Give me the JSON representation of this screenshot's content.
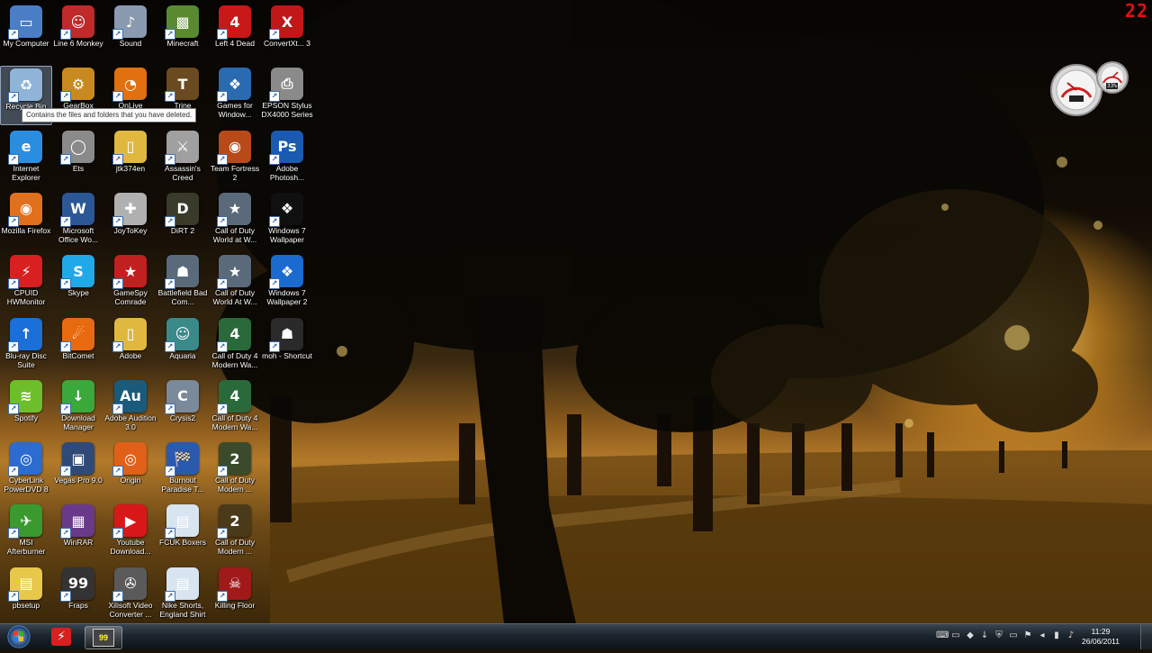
{
  "desktop": {
    "tooltip": "Contains the files and folders that you have deleted.",
    "counter": "22",
    "icons": [
      {
        "label": "My Computer",
        "icon": "computer-icon",
        "color": "#4a7fc8",
        "glyph": "▭"
      },
      {
        "label": "Recycle Bin",
        "icon": "recycle-bin-icon",
        "color": "#8fb4d8",
        "glyph": "♻",
        "selected": true
      },
      {
        "label": "Internet Explorer",
        "icon": "internet-explorer-icon",
        "color": "#2a8ee0",
        "glyph": "e"
      },
      {
        "label": "Mozilla Firefox",
        "icon": "firefox-icon",
        "color": "#e0701c",
        "glyph": "◉"
      },
      {
        "label": "CPUID HWMonitor",
        "icon": "hwmonitor-icon",
        "color": "#d82020",
        "glyph": "⚡"
      },
      {
        "label": "Blu-ray Disc Suite",
        "icon": "bluray-icon",
        "color": "#1b6fd8",
        "glyph": "↑"
      },
      {
        "label": "Spotify",
        "icon": "spotify-icon",
        "color": "#6cbf2a",
        "glyph": "≋"
      },
      {
        "label": "CyberLink PowerDVD 8",
        "icon": "powerdvd-icon",
        "color": "#2c6cd0",
        "glyph": "◎"
      },
      {
        "label": "MSI Afterburner",
        "icon": "afterburner-icon",
        "color": "#3a9a30",
        "glyph": "✈"
      },
      {
        "label": "pbsetup",
        "icon": "installer-icon",
        "color": "#e8c84a",
        "glyph": "▤"
      },
      {
        "label": "Line 6 Monkey",
        "icon": "monkey-icon",
        "color": "#c02a2a",
        "glyph": "☺"
      },
      {
        "label": "GearBox",
        "icon": "gear-icon",
        "color": "#c88a20",
        "glyph": "⚙"
      },
      {
        "label": "Ets",
        "icon": "steering-wheel-icon",
        "color": "#8a8a8a",
        "glyph": "◯"
      },
      {
        "label": "Microsoft Office Wo...",
        "icon": "word-icon",
        "color": "#2b5797",
        "glyph": "W"
      },
      {
        "label": "Skype",
        "icon": "skype-icon",
        "color": "#20a8e8",
        "glyph": "S"
      },
      {
        "label": "BitComet",
        "icon": "bitcomet-icon",
        "color": "#e86a10",
        "glyph": "☄"
      },
      {
        "label": "Download Manager",
        "icon": "download-icon",
        "color": "#3aa83a",
        "glyph": "↓"
      },
      {
        "label": "Vegas Pro 9.0",
        "icon": "vegas-icon",
        "color": "#304a78",
        "glyph": "▣"
      },
      {
        "label": "WinRAR",
        "icon": "winrar-icon",
        "color": "#6a3a8a",
        "glyph": "▦"
      },
      {
        "label": "Fraps",
        "icon": "fraps-icon",
        "color": "#333333",
        "glyph": "99"
      },
      {
        "label": "Sound",
        "icon": "sound-icon",
        "color": "#8a9ab0",
        "glyph": "♪"
      },
      {
        "label": "OnLive",
        "icon": "onlive-icon",
        "color": "#e07010",
        "glyph": "◔"
      },
      {
        "label": "jtk374en",
        "icon": "folder-icon",
        "color": "#e0b840",
        "glyph": "▯"
      },
      {
        "label": "JoyToKey",
        "icon": "joystick-icon",
        "color": "#b0b0b0",
        "glyph": "✚"
      },
      {
        "label": "GameSpy Comrade",
        "icon": "gamespy-icon",
        "color": "#c02020",
        "glyph": "★"
      },
      {
        "label": "Adobe",
        "icon": "folder-icon",
        "color": "#e0b840",
        "glyph": "▯"
      },
      {
        "label": "Adobe Audition 3.0",
        "icon": "audition-icon",
        "color": "#1a5a7a",
        "glyph": "Au"
      },
      {
        "label": "Origin",
        "icon": "origin-icon",
        "color": "#e0601a",
        "glyph": "◎"
      },
      {
        "label": "Youtube Download...",
        "icon": "youtube-icon",
        "color": "#d81818",
        "glyph": "▶"
      },
      {
        "label": "Xilisoft Video Converter ...",
        "icon": "film-reel-icon",
        "color": "#5a5a5a",
        "glyph": "✇"
      },
      {
        "label": "Minecraft",
        "icon": "minecraft-icon",
        "color": "#5a8a30",
        "glyph": "▩"
      },
      {
        "label": "Trine",
        "icon": "trine-icon",
        "color": "#6a4a20",
        "glyph": "T"
      },
      {
        "label": "Assassin's Creed",
        "icon": "assassins-creed-icon",
        "color": "#a0a0a0",
        "glyph": "⚔"
      },
      {
        "label": "DiRT 2",
        "icon": "dirt2-icon",
        "color": "#3a3a2a",
        "glyph": "D"
      },
      {
        "label": "Battlefield Bad Com...",
        "icon": "battlefield-icon",
        "color": "#5a6a7a",
        "glyph": "☗"
      },
      {
        "label": "Aquaria",
        "icon": "aquaria-icon",
        "color": "#3a8a8a",
        "glyph": "☺"
      },
      {
        "label": "Crysis2",
        "icon": "crysis-icon",
        "color": "#7a8a9a",
        "glyph": "C"
      },
      {
        "label": "Burnout Paradise T...",
        "icon": "burnout-icon",
        "color": "#2a5ab0",
        "glyph": "🏁"
      },
      {
        "label": "FCUK Boxers",
        "icon": "document-icon",
        "color": "#d8e4f0",
        "glyph": "▤"
      },
      {
        "label": "Nike Shorts, England Shirt",
        "icon": "document-icon",
        "color": "#d8e4f0",
        "glyph": "▤"
      },
      {
        "label": "Left 4 Dead",
        "icon": "left4dead-icon",
        "color": "#c81818",
        "glyph": "4"
      },
      {
        "label": "Games for Window...",
        "icon": "games-for-windows-icon",
        "color": "#2a6ab0",
        "glyph": "❖"
      },
      {
        "label": "Team Fortress 2",
        "icon": "tf2-icon",
        "color": "#b84a1a",
        "glyph": "◉"
      },
      {
        "label": "Call of Duty World at W...",
        "icon": "cod-star-icon",
        "color": "#5a6a7a",
        "glyph": "★"
      },
      {
        "label": "Call of Duty World At W...",
        "icon": "cod-star-icon",
        "color": "#5a6a7a",
        "glyph": "★"
      },
      {
        "label": "Call of Duty 4 Modern Wa...",
        "icon": "cod4-icon",
        "color": "#2a6a3a",
        "glyph": "4"
      },
      {
        "label": "Call of Duty 4 Modern Wa...",
        "icon": "cod4-icon",
        "color": "#2a6a3a",
        "glyph": "4"
      },
      {
        "label": "Call of Duty Modern ...",
        "icon": "mw2-icon",
        "color": "#3a4a2a",
        "glyph": "2"
      },
      {
        "label": "Call of Duty Modern ...",
        "icon": "mw2-icon",
        "color": "#4a3a1a",
        "glyph": "2"
      },
      {
        "label": "Killing Floor",
        "icon": "killing-floor-icon",
        "color": "#a01a1a",
        "glyph": "☠"
      },
      {
        "label": "ConvertXt... 3",
        "icon": "convertx-icon",
        "color": "#c01818",
        "glyph": "X"
      },
      {
        "label": "EPSON Stylus DX4000 Series",
        "icon": "printer-icon",
        "color": "#8a8a8a",
        "glyph": "⎙"
      },
      {
        "label": "Adobe Photosh...",
        "icon": "photoshop-icon",
        "color": "#1a5ab0",
        "glyph": "Ps"
      },
      {
        "label": "Windows 7 Wallpaper",
        "icon": "wallpaper-icon",
        "color": "#101010",
        "glyph": "❖"
      },
      {
        "label": "Windows 7 Wallpaper 2",
        "icon": "wallpaper-icon",
        "color": "#1a6ad0",
        "glyph": "❖"
      },
      {
        "label": "moh - Shortcut",
        "icon": "moh-icon",
        "color": "#2a2a2a",
        "glyph": "☗"
      }
    ]
  },
  "gadget": {
    "cpu": "29%",
    "mem": "33%"
  },
  "taskbar": {
    "clock_time": "11:29",
    "clock_date": "26/06/2011",
    "tray_icons": [
      "keyboard-icon",
      "network-flag-icon",
      "app-icon",
      "download-icon",
      "shield-icon",
      "folder-icon",
      "flag-icon",
      "speaker-icon",
      "battery-icon",
      "volume-icon"
    ]
  }
}
